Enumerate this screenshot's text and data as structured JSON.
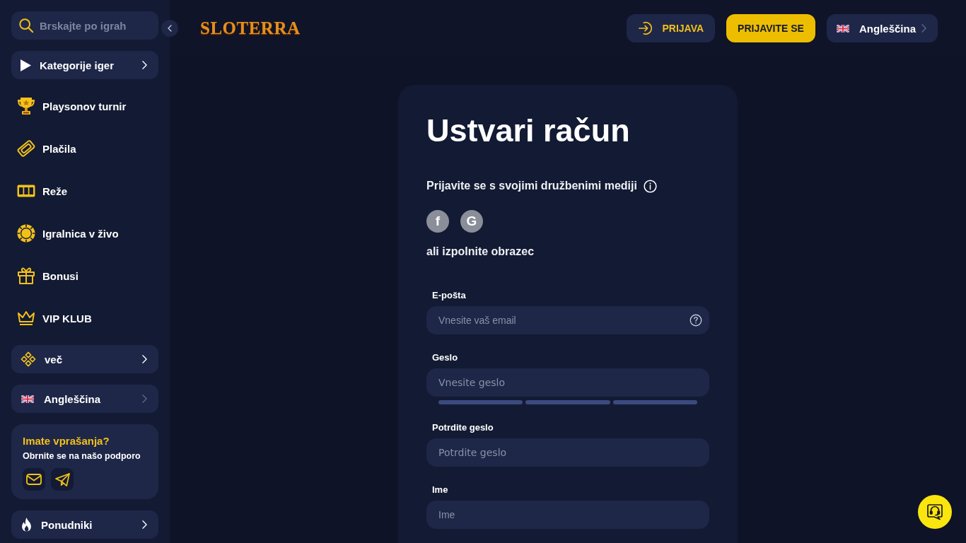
{
  "sidebar": {
    "search": {
      "placeholder": "Brskajte po igrah"
    },
    "items": [
      {
        "kind": "group",
        "label": "Kategorije iger"
      },
      {
        "kind": "link",
        "label": "Playsonov turnir"
      },
      {
        "kind": "link",
        "label": "Plačila"
      },
      {
        "kind": "link",
        "label": "Reže"
      },
      {
        "kind": "link",
        "label": "Igralnica v živo"
      },
      {
        "kind": "link",
        "label": "Bonusi"
      },
      {
        "kind": "link",
        "label": "VIP KLUB"
      },
      {
        "kind": "group",
        "label": "več"
      },
      {
        "kind": "language",
        "label": "Angleščina"
      }
    ],
    "support": {
      "title": "Imate vprašanja?",
      "text": "Obrnite se na našo podporo"
    },
    "providers": {
      "label": "Ponudniki"
    }
  },
  "header": {
    "logo": "SLOTERRA",
    "login": {
      "label": "PRIJAVA"
    },
    "register": {
      "label": "PRIJAVITE SE"
    },
    "language": {
      "label": "Angleščina"
    }
  },
  "form": {
    "title": "Ustvari račun",
    "social_prompt": "Prijavite se s svojimi družbenimi mediji",
    "social_buttons": [
      {
        "label": "f"
      },
      {
        "label": "G"
      }
    ],
    "alternative": "ali izpolnite obrazec",
    "fields": [
      {
        "kind": "email",
        "label": "E-pošta",
        "placeholder": "Vnesite vaš email",
        "help": true
      },
      {
        "kind": "password",
        "label": "Geslo",
        "placeholder": "Vnesite geslo",
        "strength_meter": true
      },
      {
        "kind": "password",
        "label": "Potrdite geslo",
        "placeholder": "Potrdite geslo"
      },
      {
        "kind": "text",
        "label": "Ime",
        "placeholder": "Ime"
      }
    ]
  }
}
